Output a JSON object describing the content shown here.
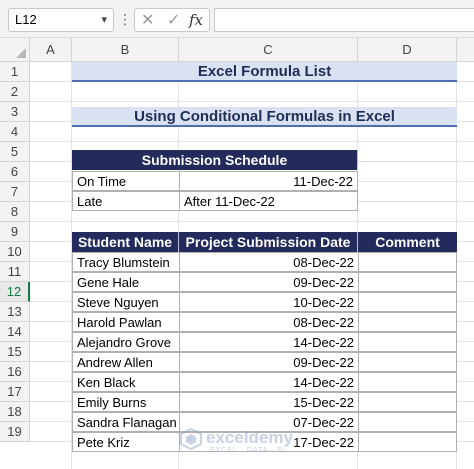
{
  "formula_bar": {
    "name_box": "L12",
    "dots": "⋮",
    "cancel_glyph": "✕",
    "enter_glyph": "✓",
    "fx_label": "fx",
    "formula": ""
  },
  "columns": [
    "A",
    "B",
    "C",
    "D"
  ],
  "rows": [
    "1",
    "2",
    "3",
    "4",
    "5",
    "6",
    "7",
    "8",
    "9",
    "10",
    "11",
    "12",
    "13",
    "14",
    "15",
    "16",
    "17",
    "18",
    "19"
  ],
  "selected_row": "12",
  "sheet": {
    "title": "Excel Formula List",
    "subtitle": "Using Conditional Formulas in Excel",
    "schedule": {
      "header": "Submission Schedule",
      "rows": [
        {
          "label": "On Time",
          "value": "11-Dec-22"
        },
        {
          "label": "Late",
          "value": "After 11-Dec-22"
        }
      ]
    },
    "table": {
      "headers": [
        "Student Name",
        "Project Submission Date",
        "Comment"
      ],
      "rows": [
        {
          "name": "Tracy Blumstein",
          "date": "08-Dec-22",
          "comment": ""
        },
        {
          "name": "Gene Hale",
          "date": "09-Dec-22",
          "comment": ""
        },
        {
          "name": "Steve Nguyen",
          "date": "10-Dec-22",
          "comment": ""
        },
        {
          "name": "Harold Pawlan",
          "date": "08-Dec-22",
          "comment": ""
        },
        {
          "name": "Alejandro Grove",
          "date": "14-Dec-22",
          "comment": ""
        },
        {
          "name": "Andrew Allen",
          "date": "09-Dec-22",
          "comment": ""
        },
        {
          "name": "Ken Black",
          "date": "14-Dec-22",
          "comment": ""
        },
        {
          "name": "Emily Burns",
          "date": "15-Dec-22",
          "comment": ""
        },
        {
          "name": "Sandra Flanagan",
          "date": "07-Dec-22",
          "comment": ""
        },
        {
          "name": "Pete Kriz",
          "date": "17-Dec-22",
          "comment": ""
        }
      ]
    }
  },
  "watermark": {
    "name": "exceldemy",
    "tagline": "EXCEL · DATA · BI"
  },
  "colors": {
    "header_dark": "#232a5c",
    "title_fill": "#d9e1f2",
    "selection": "#107c41"
  }
}
